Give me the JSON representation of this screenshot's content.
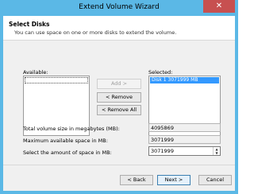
{
  "window": {
    "title": "Extend Volume Wizard",
    "close_glyph": "✕"
  },
  "header": {
    "title": "Select Disks",
    "subtitle": "You can use space on one or more disks to extend the volume."
  },
  "available": {
    "label": "Available:",
    "items": []
  },
  "selected": {
    "label": "Selected:",
    "items": [
      {
        "text": "Disk 1     3071999 MB"
      }
    ]
  },
  "buttons": {
    "add": "Add >",
    "remove": "< Remove",
    "remove_all": "< Remove All",
    "back": "< Back",
    "next": "Next >",
    "cancel": "Cancel"
  },
  "fields": {
    "total_label": "Total volume size in megabytes (MB):",
    "total_value": "4095869",
    "max_label": "Maximum available space in MB:",
    "max_value": "3071999",
    "amount_label": "Select the amount of space in MB:",
    "amount_value": "3071999"
  },
  "colors": {
    "chrome": "#5bb8e6",
    "selection": "#3399ff",
    "close": "#c75050"
  }
}
